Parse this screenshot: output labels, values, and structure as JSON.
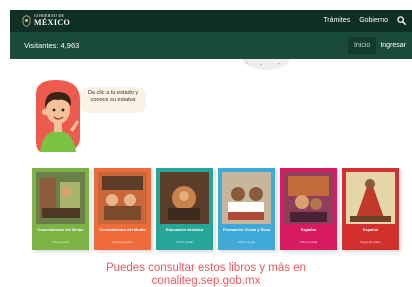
{
  "header": {
    "logo_top": "GOBIERNO DE",
    "logo_main": "MÉXICO",
    "nav": [
      "Trámites",
      "Gobierno"
    ]
  },
  "subheader": {
    "visits": "Visitantes: 4,963",
    "nav": [
      "Inicio",
      "Ingresar"
    ]
  },
  "prompt": {
    "bubble": "Da clic a tu estado y conoce su estatus"
  },
  "books": [
    {
      "title": "Conocimiento del Medio",
      "subtitle": "Primer grado",
      "color": "#7cb342"
    },
    {
      "title": "Conocimiento del Medio",
      "subtitle": "Segundo grado",
      "color": "#ef6c3a"
    },
    {
      "title": "Educación Artística",
      "subtitle": "Primer grado",
      "color": "#26a69a"
    },
    {
      "title": "Formación Cívica y Ética",
      "subtitle": "Primer grado",
      "color": "#3fa9d8"
    },
    {
      "title": "Español",
      "subtitle": "Primer grado",
      "color": "#d81b60"
    },
    {
      "title": "Español",
      "subtitle": "Segundo grado",
      "color": "#d32f2f"
    }
  ],
  "cta": {
    "line1": "Puedes consultar estos libros y más en",
    "line2": "conaliteg.sep.gob.mx"
  },
  "colors": {
    "header_bg": "#0f2e25",
    "subheader_bg": "#1a4a3c",
    "cta_text": "#e8585f"
  }
}
